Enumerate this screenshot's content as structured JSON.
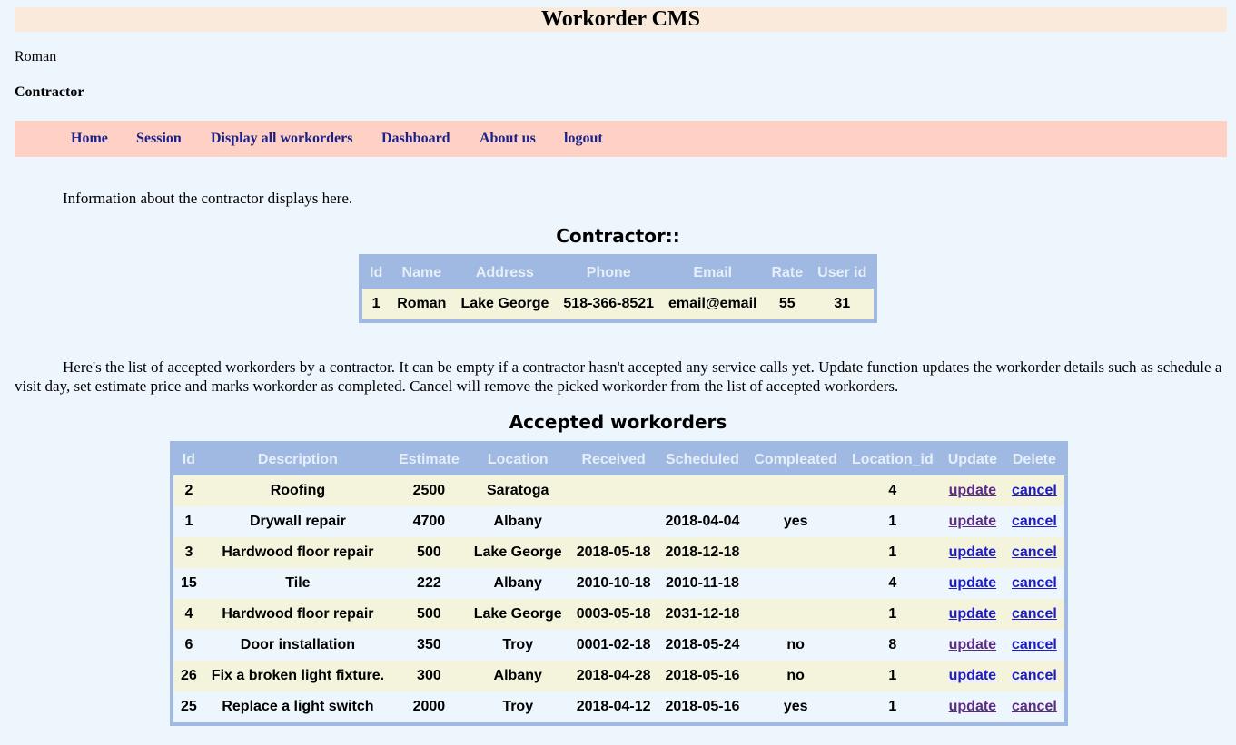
{
  "app_title": "Workorder CMS",
  "user": {
    "name": "Roman",
    "role": "Contractor"
  },
  "nav": [
    {
      "label": "Home"
    },
    {
      "label": "Session"
    },
    {
      "label": "Display all workorders"
    },
    {
      "label": "Dashboard"
    },
    {
      "label": "About us"
    },
    {
      "label": "logout"
    }
  ],
  "contractor_intro": "Information about the contractor displays here.",
  "contractor_title": "Contractor::",
  "contractor_table": {
    "headers": [
      "Id",
      "Name",
      "Address",
      "Phone",
      "Email",
      "Rate",
      "User id"
    ],
    "row": [
      "1",
      "Roman",
      "Lake George",
      "518-366-8521",
      "email@email",
      "55",
      "31"
    ]
  },
  "workorders_intro": "Here's the list of accepted workorders by a contractor. It can be empty if a contractor hasn't accepted any service calls yet. Update function updates the workorder details such as schedule a visit day, set estimate price and marks workorder as completed. Cancel will remove the picked workorder from the list of accepted workorders.",
  "workorders_title": "Accepted workorders",
  "workorders_table": {
    "headers": [
      "Id",
      "Description",
      "Estimate",
      "Location",
      "Received",
      "Scheduled",
      "Compleated",
      "Location_id",
      "Update",
      "Delete"
    ],
    "update_label": "update",
    "cancel_label": "cancel",
    "rows": [
      {
        "id": "2",
        "description": "Roofing",
        "estimate": "2500",
        "location": "Saratoga",
        "received": "",
        "scheduled": "",
        "completed": "",
        "location_id": "4"
      },
      {
        "id": "1",
        "description": "Drywall repair",
        "estimate": "4700",
        "location": "Albany",
        "received": "",
        "scheduled": "2018-04-04",
        "completed": "yes",
        "location_id": "1"
      },
      {
        "id": "3",
        "description": "Hardwood floor repair",
        "estimate": "500",
        "location": "Lake George",
        "received": "2018-05-18",
        "scheduled": "2018-12-18",
        "completed": "",
        "location_id": "1"
      },
      {
        "id": "15",
        "description": "Tile",
        "estimate": "222",
        "location": "Albany",
        "received": "2010-10-18",
        "scheduled": "2010-11-18",
        "completed": "",
        "location_id": "4"
      },
      {
        "id": "4",
        "description": "Hardwood floor repair",
        "estimate": "500",
        "location": "Lake George",
        "received": "0003-05-18",
        "scheduled": "2031-12-18",
        "completed": "",
        "location_id": "1"
      },
      {
        "id": "6",
        "description": "Door installation",
        "estimate": "350",
        "location": "Troy",
        "received": "0001-02-18",
        "scheduled": "2018-05-24",
        "completed": "no",
        "location_id": "8"
      },
      {
        "id": "26",
        "description": "Fix a broken light fixture.",
        "estimate": "300",
        "location": "Albany",
        "received": "2018-04-28",
        "scheduled": "2018-05-16",
        "completed": "no",
        "location_id": "1"
      },
      {
        "id": "25",
        "description": "Replace a light switch",
        "estimate": "2000",
        "location": "Troy",
        "received": "2018-04-12",
        "scheduled": "2018-05-16",
        "completed": "yes",
        "location_id": "1"
      }
    ]
  },
  "colors": {
    "page_bg": "#eef6fd",
    "title_bg": "#faeadb",
    "nav_bg": "#ffd1c4",
    "nav_link": "#1a2288",
    "table_border": "#9fb9e2",
    "row_alt": "#f4f4dd",
    "link": "#1c1ac9",
    "link_visited": "#5b2b86"
  }
}
